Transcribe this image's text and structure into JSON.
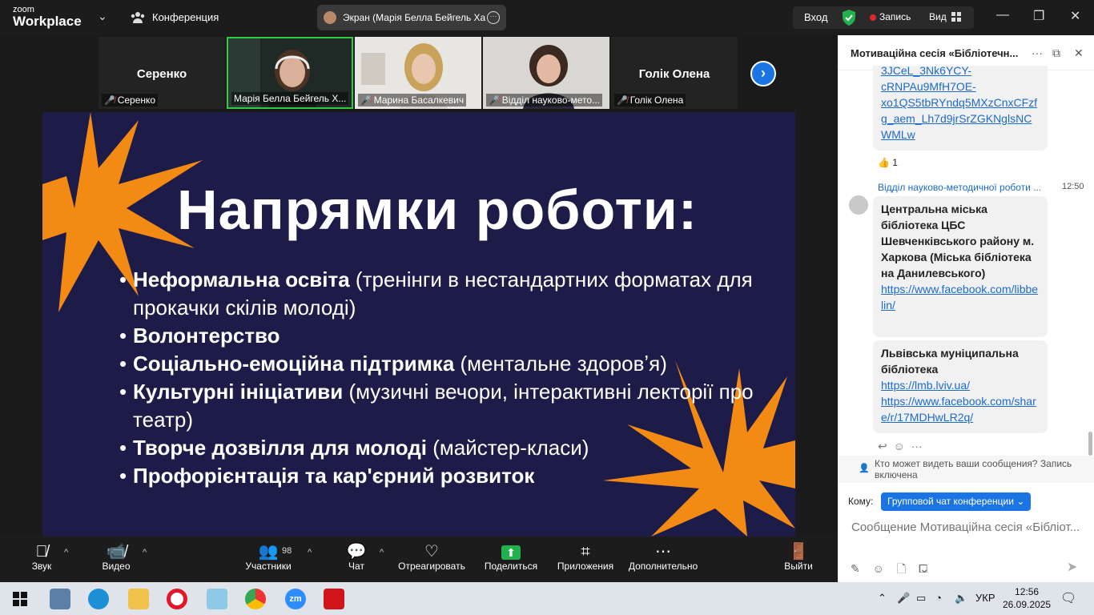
{
  "app": {
    "brand_small": "zoom",
    "brand_big": "Workplace"
  },
  "topbar": {
    "conference_label": "Конференция",
    "screen_share_label": "Экран (Марія Белла Бейгель Ха",
    "login_label": "Вход",
    "record_label": "Запись",
    "view_label": "Вид"
  },
  "participants_strip": [
    {
      "big_name": "Серенко",
      "label": "Серенко",
      "video": false,
      "muted": true
    },
    {
      "big_name": "",
      "label": "Марія Белла Бейгель Х...",
      "video": true,
      "muted": false,
      "active": true
    },
    {
      "big_name": "",
      "label": "Марина Басалкевич",
      "video": true,
      "muted": true
    },
    {
      "big_name": "",
      "label": "Відділ науково-мето...",
      "video": true,
      "muted": true
    },
    {
      "big_name": "Голік Олена",
      "label": "Голік Олена",
      "video": false,
      "muted": true
    }
  ],
  "slide": {
    "title": "Напрямки роботи:",
    "bullets": [
      {
        "bold": "Неформальна освіта",
        "rest": " (тренінги в нестандартних форматах для прокачки скілів молоді)"
      },
      {
        "bold": "Волонтерство",
        "rest": ""
      },
      {
        "bold": "Соціально-емоційна підтримка",
        "rest": " (ментальне здоровʼя)"
      },
      {
        "bold": "Культурні ініціативи",
        "rest": " (музичні вечори, інтерактивні лекторії про театр)"
      },
      {
        "bold": "Творче дозвілля для молоді",
        "rest": " (майстер-класи)"
      },
      {
        "bold": "Профорієнтація та кар'єрний розвиток",
        "rest": ""
      }
    ],
    "colors": {
      "background": "#1d1c48",
      "accent": "#f28a14"
    }
  },
  "chat": {
    "title": "Мотиваційна сесія «Бібліотечн...",
    "prev_link_lines": [
      "3JCeL_3Nk6YCY-",
      "cRNPAu9MfH7OE-",
      "xo1QS5tbRYndq5MXzCnxCFzf",
      "g_aem_Lh7d9jrSrZGKNglsNC",
      "WMLw"
    ],
    "reaction": {
      "emoji": "👍",
      "count": "1"
    },
    "sender": "Відділ науково-методичної роботи ...",
    "time": "12:50",
    "message1": {
      "bold": "Центральна міська бібліотека ЦБС Шевченківського району м. Харкова (Міська бібліотека на Данилевського)",
      "link": "https://www.facebook.com/libbelin/"
    },
    "message2": {
      "bold": "Львівська муніципальна бібліотека",
      "link1": "https://lmb.lviv.ua/",
      "link2": "https://www.facebook.com/share/r/17MDHwLR2q/"
    },
    "visibility_note": "Кто может видеть ваши сообщения? Запись включена",
    "to_label": "Кому:",
    "to_value": "Групповой чат конференции",
    "compose_placeholder": "Сообщение Мотиваційна сесія «Бібліот..."
  },
  "toolbar": {
    "sound": "Звук",
    "video": "Видео",
    "participants": "Участники",
    "participants_count": "98",
    "chat": "Чат",
    "react": "Отреагировать",
    "share": "Поделиться",
    "apps": "Приложения",
    "more": "Дополнительно",
    "leave": "Выйти"
  },
  "taskbar": {
    "lang": "УКР",
    "time": "12:56",
    "date": "26.09.2025"
  }
}
